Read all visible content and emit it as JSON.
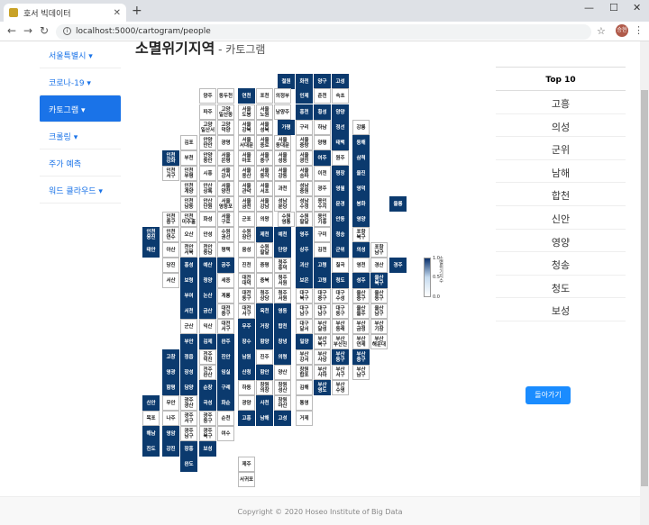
{
  "browser": {
    "tab_title": "호서 빅데이터",
    "url": "localhost:5000/cartogram/people",
    "avatar": "승현"
  },
  "sidebar": [
    {
      "label": "서울특별시 ▾"
    },
    {
      "label": "코로나-19 ▾"
    },
    {
      "label": "카토그램 ▾",
      "active": true
    },
    {
      "label": "크롤링 ▾"
    },
    {
      "label": "주가 예측"
    },
    {
      "label": "워드 클라우드 ▾"
    }
  ],
  "page": {
    "title": "소멸위기지역",
    "subtitle": " - 카토그램"
  },
  "legend": {
    "max": "1.0",
    "mid": "0.5",
    "min": "0.0",
    "title": "소멸위기지수"
  },
  "ranking": {
    "header": "Top 10",
    "items": [
      "고흥",
      "의성",
      "군위",
      "남해",
      "합천",
      "신안",
      "영양",
      "청송",
      "청도",
      "보성"
    ],
    "back": "돌아가기"
  },
  "footer": "Copyright © 2020 Hoseo Institute of Big Data",
  "cells": [
    [
      "철원",
      308,
      36,
      "d"
    ],
    [
      "화천",
      328,
      36,
      "d"
    ],
    [
      "양구",
      348,
      36,
      "d"
    ],
    [
      "고성",
      368,
      36,
      "d"
    ],
    [
      "양주",
      221,
      52,
      "l"
    ],
    [
      "동두천",
      241,
      52,
      "l"
    ],
    [
      "연천",
      264,
      52,
      "d"
    ],
    [
      "포천",
      284,
      52,
      "l"
    ],
    [
      "의정부",
      304,
      52,
      "l"
    ],
    [
      "인제",
      328,
      52,
      "d"
    ],
    [
      "춘천",
      348,
      52,
      "l"
    ],
    [
      "속초",
      368,
      52,
      "l"
    ],
    [
      "파주",
      221,
      70,
      "l"
    ],
    [
      "고양 일산동",
      241,
      70,
      "l"
    ],
    [
      "서울 도봉",
      264,
      70,
      "l"
    ],
    [
      "서울 노원",
      284,
      70,
      "l"
    ],
    [
      "남양주",
      304,
      70,
      "l"
    ],
    [
      "홍천",
      328,
      70,
      "d"
    ],
    [
      "횡성",
      348,
      70,
      "d"
    ],
    [
      "양양",
      368,
      70,
      "d"
    ],
    [
      "고양 일산서",
      221,
      87,
      "l"
    ],
    [
      "고양 덕양",
      241,
      87,
      "l"
    ],
    [
      "서울 강북",
      264,
      87,
      "l"
    ],
    [
      "서울 성북",
      284,
      87,
      "l"
    ],
    [
      "가평",
      308,
      87,
      "d"
    ],
    [
      "구리",
      328,
      87,
      "l"
    ],
    [
      "하남",
      348,
      87,
      "l"
    ],
    [
      "정선",
      368,
      87,
      "d"
    ],
    [
      "강릉",
      391,
      87,
      "l"
    ],
    [
      "김포",
      200,
      104,
      "l"
    ],
    [
      "안양 만안",
      221,
      104,
      "l"
    ],
    [
      "광명",
      241,
      104,
      "l"
    ],
    [
      "서울 서대문",
      264,
      104,
      "l"
    ],
    [
      "서울 종로",
      284,
      104,
      "l"
    ],
    [
      "서울 동대문",
      304,
      104,
      "l"
    ],
    [
      "서울 중랑",
      328,
      104,
      "l"
    ],
    [
      "양평",
      348,
      104,
      "l"
    ],
    [
      "태백",
      368,
      104,
      "d"
    ],
    [
      "동해",
      391,
      104,
      "d"
    ],
    [
      "인천 강화",
      180,
      121,
      "d"
    ],
    [
      "부천",
      200,
      121,
      "l"
    ],
    [
      "안양 동안",
      221,
      121,
      "l"
    ],
    [
      "서울 은평",
      241,
      121,
      "l"
    ],
    [
      "서울 마포",
      264,
      121,
      "l"
    ],
    [
      "서울 중구",
      284,
      121,
      "l"
    ],
    [
      "서울 성동",
      304,
      121,
      "l"
    ],
    [
      "서울 광진",
      328,
      121,
      "l"
    ],
    [
      "여주",
      348,
      121,
      "d"
    ],
    [
      "원주",
      368,
      121,
      "l"
    ],
    [
      "삼척",
      391,
      121,
      "d"
    ],
    [
      "인천 서구",
      180,
      138,
      "l"
    ],
    [
      "인천 부평",
      200,
      138,
      "l"
    ],
    [
      "시흥",
      221,
      138,
      "l"
    ],
    [
      "서울 강서",
      241,
      138,
      "l"
    ],
    [
      "서울 용산",
      264,
      138,
      "l"
    ],
    [
      "서울 동작",
      284,
      138,
      "l"
    ],
    [
      "서울 강동",
      304,
      138,
      "l"
    ],
    [
      "서울 송파",
      328,
      138,
      "l"
    ],
    [
      "이천",
      348,
      138,
      "l"
    ],
    [
      "평창",
      368,
      138,
      "d"
    ],
    [
      "울진",
      391,
      138,
      "d"
    ],
    [
      "인천 계양",
      200,
      155,
      "l"
    ],
    [
      "안산 상록",
      221,
      155,
      "l"
    ],
    [
      "서울 양천",
      241,
      155,
      "l"
    ],
    [
      "서울 관악",
      264,
      155,
      "l"
    ],
    [
      "서울 서초",
      284,
      155,
      "l"
    ],
    [
      "과천",
      304,
      155,
      "l"
    ],
    [
      "성남 중원",
      328,
      155,
      "l"
    ],
    [
      "광주",
      348,
      155,
      "l"
    ],
    [
      "영월",
      368,
      155,
      "d"
    ],
    [
      "영덕",
      391,
      155,
      "d"
    ],
    [
      "인천 남동",
      200,
      172,
      "l"
    ],
    [
      "안산 단원",
      221,
      172,
      "l"
    ],
    [
      "서울 영등포",
      241,
      172,
      "l"
    ],
    [
      "서울 금천",
      264,
      172,
      "l"
    ],
    [
      "서울 강남",
      284,
      172,
      "l"
    ],
    [
      "성남 분당",
      304,
      172,
      "l"
    ],
    [
      "성남 수정",
      328,
      172,
      "l"
    ],
    [
      "용인 수지",
      348,
      172,
      "l"
    ],
    [
      "문경",
      368,
      172,
      "d"
    ],
    [
      "봉화",
      391,
      172,
      "d"
    ],
    [
      "울릉",
      432,
      172,
      "d"
    ],
    [
      "인천 중구",
      180,
      189,
      "l"
    ],
    [
      "인천 미추홀",
      200,
      189,
      "l"
    ],
    [
      "화성",
      221,
      189,
      "l"
    ],
    [
      "서울 구로",
      241,
      189,
      "l"
    ],
    [
      "군포",
      264,
      189,
      "l"
    ],
    [
      "의왕",
      284,
      189,
      "l"
    ],
    [
      "수원 영통",
      308,
      189,
      "l"
    ],
    [
      "수원 팔달",
      328,
      189,
      "l"
    ],
    [
      "용인 기흥",
      348,
      189,
      "l"
    ],
    [
      "안동",
      368,
      189,
      "d"
    ],
    [
      "영양",
      391,
      189,
      "d"
    ],
    [
      "인천 옹진",
      158,
      206,
      "d"
    ],
    [
      "인천 연수",
      180,
      206,
      "l"
    ],
    [
      "오산",
      200,
      206,
      "l"
    ],
    [
      "안성",
      221,
      206,
      "l"
    ],
    [
      "수원 권선",
      241,
      206,
      "l"
    ],
    [
      "수원 장안",
      264,
      206,
      "l"
    ],
    [
      "제천",
      284,
      206,
      "d"
    ],
    [
      "예천",
      304,
      206,
      "d"
    ],
    [
      "영주",
      328,
      206,
      "d"
    ],
    [
      "구미",
      348,
      206,
      "l"
    ],
    [
      "청송",
      368,
      206,
      "d"
    ],
    [
      "포항 북구",
      391,
      206,
      "l"
    ],
    [
      "태안",
      158,
      223,
      "d"
    ],
    [
      "아산",
      180,
      223,
      "l"
    ],
    [
      "천안 서북",
      200,
      223,
      "l"
    ],
    [
      "천안 동남",
      221,
      223,
      "l"
    ],
    [
      "평택",
      241,
      223,
      "l"
    ],
    [
      "음성",
      264,
      223,
      "l"
    ],
    [
      "수원 팔달",
      284,
      223,
      "l"
    ],
    [
      "단양",
      304,
      223,
      "d"
    ],
    [
      "상주",
      328,
      223,
      "d"
    ],
    [
      "김천",
      348,
      223,
      "l"
    ],
    [
      "군위",
      368,
      223,
      "d"
    ],
    [
      "의성",
      391,
      223,
      "d"
    ],
    [
      "포항 남구",
      411,
      223,
      "l"
    ],
    [
      "당진",
      180,
      240,
      "l"
    ],
    [
      "홍성",
      200,
      240,
      "d"
    ],
    [
      "예산",
      221,
      240,
      "d"
    ],
    [
      "공주",
      241,
      240,
      "d"
    ],
    [
      "진천",
      264,
      240,
      "l"
    ],
    [
      "증평",
      284,
      240,
      "l"
    ],
    [
      "청주 흥덕",
      304,
      240,
      "l"
    ],
    [
      "괴산",
      328,
      240,
      "d"
    ],
    [
      "고령",
      348,
      240,
      "d"
    ],
    [
      "칠곡",
      368,
      240,
      "l"
    ],
    [
      "영천",
      391,
      240,
      "l"
    ],
    [
      "경산",
      411,
      240,
      "l"
    ],
    [
      "경주",
      432,
      240,
      "d"
    ],
    [
      "서산",
      180,
      257,
      "l"
    ],
    [
      "보령",
      200,
      257,
      "d"
    ],
    [
      "청양",
      221,
      257,
      "d"
    ],
    [
      "세종",
      241,
      257,
      "l"
    ],
    [
      "대전 대덕",
      264,
      257,
      "l"
    ],
    [
      "충북",
      284,
      257,
      "l"
    ],
    [
      "청주 서원",
      304,
      257,
      "l"
    ],
    [
      "보은",
      328,
      257,
      "d"
    ],
    [
      "고령",
      348,
      257,
      "d"
    ],
    [
      "청도",
      368,
      257,
      "d"
    ],
    [
      "성주",
      391,
      257,
      "d"
    ],
    [
      "울산 북구",
      411,
      257,
      "d"
    ],
    [
      "부여",
      200,
      274,
      "d"
    ],
    [
      "논산",
      221,
      274,
      "d"
    ],
    [
      "계룡",
      241,
      274,
      "l"
    ],
    [
      "대전 동구",
      264,
      274,
      "l"
    ],
    [
      "청주 상당",
      284,
      274,
      "l"
    ],
    [
      "청주 서원",
      304,
      274,
      "l"
    ],
    [
      "대구 북구",
      328,
      274,
      "l"
    ],
    [
      "대구 중구",
      348,
      274,
      "l"
    ],
    [
      "대구 수성",
      368,
      274,
      "l"
    ],
    [
      "울산 중구",
      391,
      274,
      "l"
    ],
    [
      "울산 동구",
      411,
      274,
      "l"
    ],
    [
      "서천",
      200,
      291,
      "d"
    ],
    [
      "금산",
      221,
      291,
      "d"
    ],
    [
      "대전 중구",
      241,
      291,
      "l"
    ],
    [
      "대전 서구",
      264,
      291,
      "l"
    ],
    [
      "옥천",
      284,
      291,
      "d"
    ],
    [
      "영동",
      304,
      291,
      "d"
    ],
    [
      "대구 남구",
      328,
      291,
      "l"
    ],
    [
      "대구 남구",
      348,
      291,
      "l"
    ],
    [
      "대구 동구",
      368,
      291,
      "l"
    ],
    [
      "울산 울주",
      391,
      291,
      "l"
    ],
    [
      "울산 남구",
      411,
      291,
      "l"
    ],
    [
      "군산",
      200,
      308,
      "l"
    ],
    [
      "익산",
      221,
      308,
      "l"
    ],
    [
      "대전 서구",
      241,
      308,
      "l"
    ],
    [
      "무주",
      264,
      308,
      "d"
    ],
    [
      "거창",
      284,
      308,
      "d"
    ],
    [
      "합천",
      304,
      308,
      "d"
    ],
    [
      "대구 달서",
      328,
      308,
      "l"
    ],
    [
      "부산 달성",
      348,
      308,
      "l"
    ],
    [
      "부산 동래",
      368,
      308,
      "l"
    ],
    [
      "부산 금정",
      391,
      308,
      "l"
    ],
    [
      "부산 기장",
      411,
      308,
      "l"
    ],
    [
      "부안",
      200,
      325,
      "d"
    ],
    [
      "김제",
      221,
      325,
      "d"
    ],
    [
      "완주",
      241,
      325,
      "d"
    ],
    [
      "장수",
      264,
      325,
      "d"
    ],
    [
      "함양",
      284,
      325,
      "d"
    ],
    [
      "창녕",
      304,
      325,
      "d"
    ],
    [
      "밀양",
      328,
      325,
      "d"
    ],
    [
      "부산 북구",
      348,
      325,
      "l"
    ],
    [
      "부산 부산진",
      368,
      325,
      "l"
    ],
    [
      "부산 연제",
      391,
      325,
      "l"
    ],
    [
      "부산 해운대",
      411,
      325,
      "l"
    ],
    [
      "고창",
      180,
      342,
      "d"
    ],
    [
      "정읍",
      200,
      342,
      "d"
    ],
    [
      "전주 덕진",
      221,
      342,
      "l"
    ],
    [
      "진안",
      241,
      342,
      "d"
    ],
    [
      "남원",
      264,
      342,
      "d"
    ],
    [
      "진주",
      284,
      342,
      "l"
    ],
    [
      "의령",
      304,
      342,
      "d"
    ],
    [
      "부산 강서",
      328,
      342,
      "l"
    ],
    [
      "부산 사상",
      348,
      342,
      "l"
    ],
    [
      "부산 동구",
      368,
      342,
      "d"
    ],
    [
      "부산 중구",
      391,
      342,
      "d"
    ],
    [
      "영광",
      180,
      359,
      "d"
    ],
    [
      "장성",
      200,
      359,
      "d"
    ],
    [
      "전주 완산",
      221,
      359,
      "l"
    ],
    [
      "임실",
      241,
      359,
      "d"
    ],
    [
      "산청",
      264,
      359,
      "d"
    ],
    [
      "함안",
      284,
      359,
      "d"
    ],
    [
      "양산",
      304,
      359,
      "l"
    ],
    [
      "창원 합포",
      328,
      359,
      "l"
    ],
    [
      "부산 사하",
      348,
      359,
      "l"
    ],
    [
      "부산 서구",
      368,
      359,
      "l"
    ],
    [
      "부산 남구",
      391,
      359,
      "l"
    ],
    [
      "함평",
      180,
      376,
      "d"
    ],
    [
      "담양",
      200,
      376,
      "d"
    ],
    [
      "순창",
      221,
      376,
      "d"
    ],
    [
      "구례",
      241,
      376,
      "d"
    ],
    [
      "하동",
      264,
      376,
      "l"
    ],
    [
      "창원 의창",
      284,
      376,
      "l"
    ],
    [
      "창원 성산",
      304,
      376,
      "l"
    ],
    [
      "김해",
      328,
      376,
      "l"
    ],
    [
      "부산 영도",
      348,
      376,
      "d"
    ],
    [
      "부산 수영",
      368,
      376,
      "l"
    ],
    [
      "신안",
      158,
      393,
      "d"
    ],
    [
      "무안",
      180,
      393,
      "l"
    ],
    [
      "광주 광산",
      200,
      393,
      "l"
    ],
    [
      "곡성",
      221,
      393,
      "d"
    ],
    [
      "화순",
      241,
      393,
      "d"
    ],
    [
      "광양",
      264,
      393,
      "l"
    ],
    [
      "사천",
      284,
      393,
      "d"
    ],
    [
      "창원 마산",
      304,
      393,
      "l"
    ],
    [
      "통영",
      328,
      393,
      "l"
    ],
    [
      "목포",
      158,
      410,
      "l"
    ],
    [
      "나주",
      180,
      410,
      "l"
    ],
    [
      "광주 서구",
      200,
      410,
      "l"
    ],
    [
      "광주 동구",
      221,
      410,
      "l"
    ],
    [
      "순천",
      241,
      410,
      "l"
    ],
    [
      "고흥",
      264,
      410,
      "d"
    ],
    [
      "남해",
      284,
      410,
      "d"
    ],
    [
      "고성",
      304,
      410,
      "d"
    ],
    [
      "거제",
      328,
      410,
      "l"
    ],
    [
      "해남",
      158,
      427,
      "d"
    ],
    [
      "영암",
      180,
      427,
      "d"
    ],
    [
      "광주 남구",
      200,
      427,
      "l"
    ],
    [
      "광주 북구",
      221,
      427,
      "l"
    ],
    [
      "여수",
      241,
      427,
      "l"
    ],
    [
      "진도",
      158,
      444,
      "d"
    ],
    [
      "강진",
      180,
      444,
      "d"
    ],
    [
      "장흥",
      200,
      444,
      "d"
    ],
    [
      "보성",
      221,
      444,
      "d"
    ],
    [
      "완도",
      200,
      461,
      "d"
    ],
    [
      "제주",
      264,
      461,
      "l"
    ],
    [
      "서귀포",
      264,
      478,
      "l"
    ]
  ]
}
